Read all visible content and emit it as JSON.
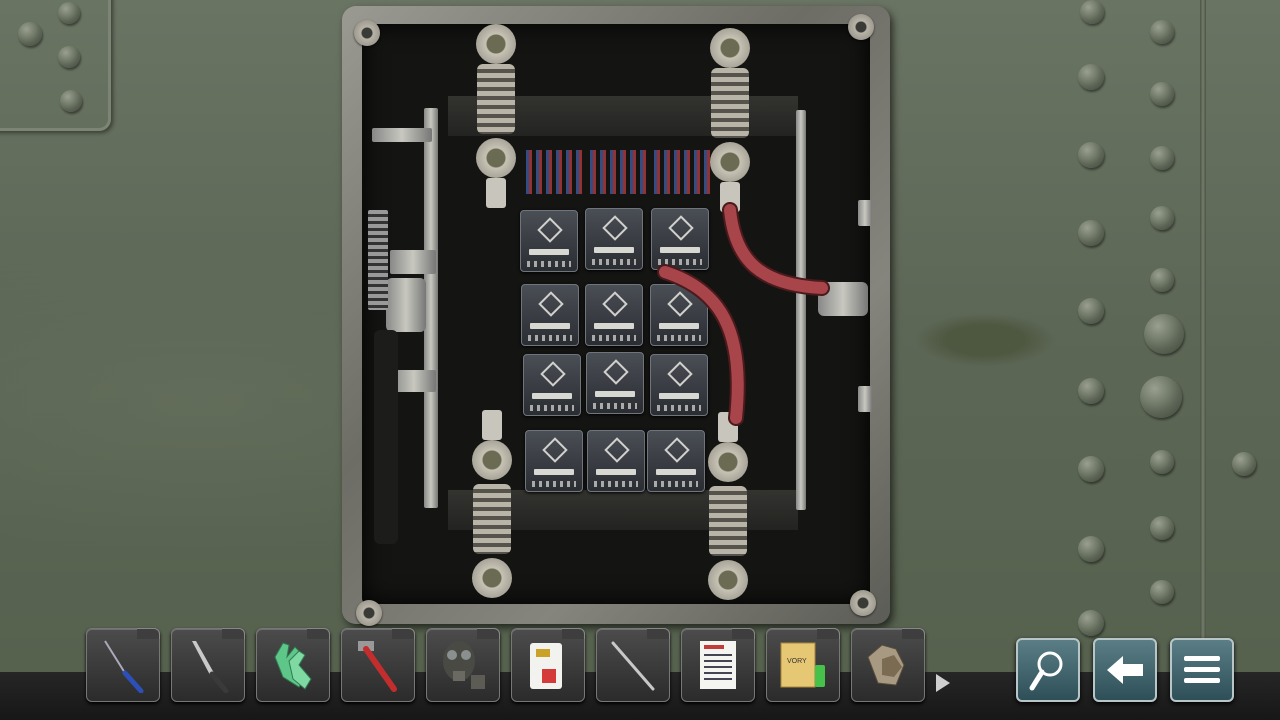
{
  "scene": {
    "name": "fuse-box-closeup"
  },
  "inventory": {
    "items": [
      {
        "icon": "screwdriver-icon"
      },
      {
        "icon": "knife-icon"
      },
      {
        "icon": "rubber-gloves-icon"
      },
      {
        "icon": "pipe-wrench-icon"
      },
      {
        "icon": "gas-mask-icon"
      },
      {
        "icon": "id-card-icon"
      },
      {
        "icon": "scalpel-icon"
      },
      {
        "icon": "document-list-icon"
      },
      {
        "icon": "folder-with-bottle-icon",
        "folder_text": "VORY"
      },
      {
        "icon": "work-gloves-icon"
      }
    ],
    "more_icon": "arrow-right-icon"
  },
  "controls": {
    "hint_icon": "magnifier-icon",
    "back_icon": "back-arrow-icon",
    "menu_icon": "menu-icon"
  },
  "colors": {
    "wall": "#5d6756",
    "cable": "#a8454a",
    "button": "#3e6068"
  }
}
